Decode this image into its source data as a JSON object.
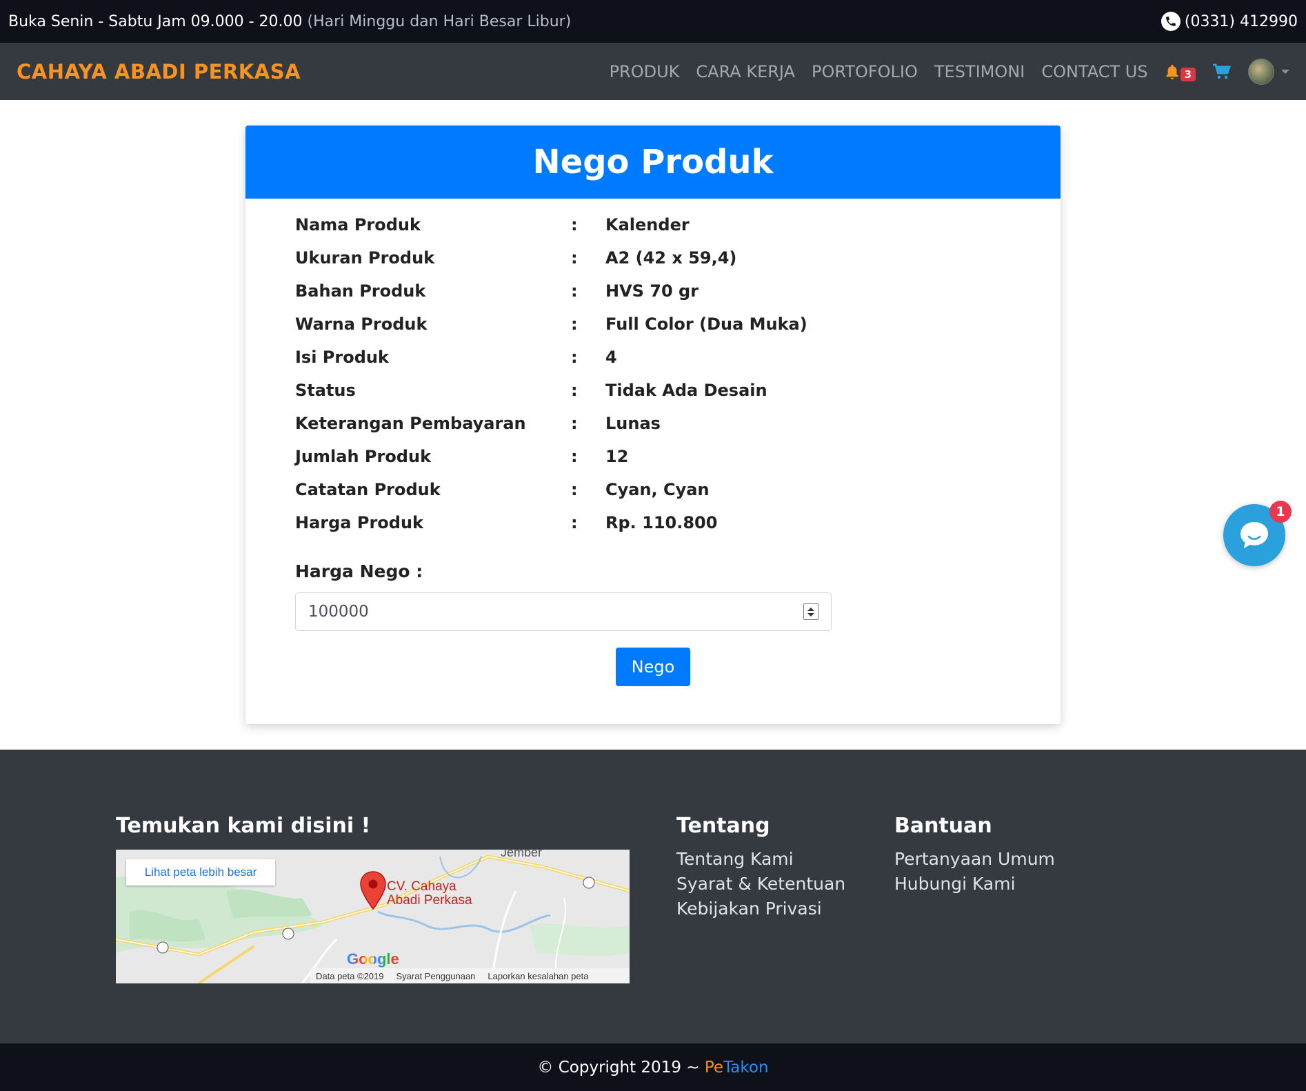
{
  "topbar": {
    "hours": "Buka Senin - Sabtu Jam 09.000 - 20.00",
    "hours_note": "(Hari Minggu dan Hari Besar Libur)",
    "phone": "(0331) 412990",
    "phone_icon": "phone-icon"
  },
  "navbar": {
    "brand": "CAHAYA ABADI PERKASA",
    "links": [
      "PRODUK",
      "CARA KERJA",
      "PORTOFOLIO",
      "TESTIMONI",
      "CONTACT US"
    ],
    "notification_count": "3",
    "icons": [
      "bell-icon",
      "cart-icon",
      "avatar",
      "chevron-down-icon"
    ],
    "colors": {
      "brand": "#f7931e",
      "bell": "#f7931e",
      "cart": "#2aa0dc"
    }
  },
  "card": {
    "title": "Nego Produk",
    "rows": [
      {
        "label": "Nama Produk",
        "value": "Kalender"
      },
      {
        "label": "Ukuran Produk",
        "value": "A2 (42 x 59,4)"
      },
      {
        "label": "Bahan Produk",
        "value": "HVS 70 gr"
      },
      {
        "label": "Warna Produk",
        "value": "Full Color (Dua Muka)"
      },
      {
        "label": "Isi Produk",
        "value": "4"
      },
      {
        "label": "Status",
        "value": "Tidak Ada Desain"
      },
      {
        "label": "Keterangan Pembayaran",
        "value": "Lunas"
      },
      {
        "label": "Jumlah Produk",
        "value": "12"
      },
      {
        "label": "Catatan Produk",
        "value": "Cyan, Cyan"
      },
      {
        "label": "Harga Produk",
        "value": "Rp. 110.800"
      }
    ],
    "separator": ":",
    "nego_label": "Harga Nego :",
    "nego_value": "100000",
    "nego_button": "Nego",
    "header_color": "#007bff"
  },
  "chat": {
    "badge": "1",
    "icon": "chat-bubble-icon",
    "color": "#2aa0dc"
  },
  "footer": {
    "map_title": "Temukan kami disini !",
    "map": {
      "enlarge_link": "Lihat peta lebih besar",
      "place_label_line1": "CV. Cahaya",
      "place_label_line2": "Abadi Perkasa",
      "city": "Jember",
      "google": "Google",
      "data_text": "Data peta ©2019",
      "terms": "Syarat Penggunaan",
      "report": "Laporkan kesalahan peta"
    },
    "tentang": {
      "title": "Tentang",
      "links": [
        "Tentang Kami",
        "Syarat & Ketentuan",
        "Kebijakan Privasi"
      ]
    },
    "bantuan": {
      "title": "Bantuan",
      "links": [
        "Pertanyaan Umum",
        "Hubungi Kami"
      ]
    }
  },
  "copyright": {
    "text": "© Copyright 2019 ~ ",
    "pe": "Pe",
    "takon": "Takon"
  }
}
